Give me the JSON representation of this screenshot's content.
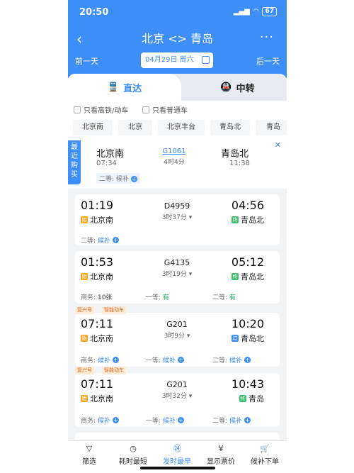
{
  "status": {
    "time": "20:50",
    "battery": "67"
  },
  "nav": {
    "title": "北京 <> 青岛",
    "prev_day": "前一天",
    "next_day": "后一天",
    "date": "04月29日 周六"
  },
  "tabs": {
    "direct": "直达",
    "transfer": "中转"
  },
  "filters": {
    "high_speed": "只看高铁/动车",
    "normal": "只看普通车"
  },
  "stations": [
    "北京南",
    "北京",
    "北京丰台",
    "青岛北",
    "青岛"
  ],
  "recent": {
    "tag": "最近购买",
    "from": "北京南",
    "from_time": "07:34",
    "train": "G1061",
    "duration": "4时4分",
    "to": "青岛北",
    "to_time": "11:38",
    "seat": "二等: 候补"
  },
  "trains": [
    {
      "dep": "01:19",
      "from": "北京南",
      "from_badge": "始",
      "num": "D4959",
      "dur": "3时37分",
      "arr": "04:56",
      "to": "青岛北",
      "to_badge": "终",
      "seats": [
        {
          "label": "二等:",
          "value": "候补"
        }
      ]
    },
    {
      "dep": "01:53",
      "from": "北京南",
      "from_badge": "始",
      "num": "G4135",
      "dur": "3时19分",
      "arr": "05:12",
      "to": "青岛北",
      "to_badge": "终",
      "seats": [
        {
          "label": "商务:",
          "value": "10张"
        },
        {
          "label": "一等:",
          "value": "有"
        },
        {
          "label": "二等:",
          "value": "有"
        }
      ]
    },
    {
      "tags": [
        "复兴号",
        "智能动车"
      ],
      "dep": "07:11",
      "from": "北京南",
      "from_badge": "始",
      "num": "G201",
      "dur": "3时9分",
      "arr": "10:20",
      "to": "青岛北",
      "to_badge": "过",
      "seats": [
        {
          "label": "商务:",
          "value": "候补"
        },
        {
          "label": "一等:",
          "value": "候补"
        },
        {
          "label": "二等:",
          "value": "候补"
        }
      ]
    },
    {
      "tags": [
        "复兴号",
        "智能动车"
      ],
      "dep": "07:11",
      "from": "北京南",
      "from_badge": "始",
      "num": "G201",
      "dur": "3时32分",
      "arr": "10:43",
      "to": "青岛",
      "to_badge": "终",
      "seats": [
        {
          "label": "商务:",
          "value": "候补"
        },
        {
          "label": "一等:",
          "value": "候补"
        },
        {
          "label": "二等:",
          "value": "候补"
        }
      ]
    }
  ],
  "bottom": {
    "filter": "筛选",
    "shortest": "耗时最短",
    "earliest": "发时最早",
    "price": "显示票价",
    "waitlist": "候补下单"
  }
}
